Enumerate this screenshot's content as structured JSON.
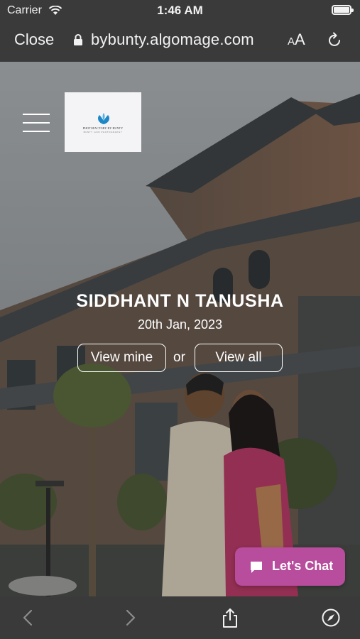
{
  "status_bar": {
    "carrier": "Carrier",
    "time": "1:46 AM",
    "battery_level": 1.0
  },
  "browser": {
    "close_label": "Close",
    "url": "bybunty.algomage.com",
    "text_size_small": "A",
    "text_size_big": "A",
    "icons": {
      "lock": "lock-icon",
      "reload": "reload-icon",
      "back": "back-arrow-icon",
      "forward": "forward-arrow-icon",
      "share": "share-icon",
      "compass": "compass-icon"
    }
  },
  "page": {
    "logo_name": "PHOTOFACTORY BY BUNTY",
    "logo_tagline": "BUNTY JAIN PHOTOGRAPHY",
    "couple_name": "SIDDHANT N TANUSHA",
    "event_date": "20th Jan, 2023",
    "view_mine_label": "View mine",
    "or_label": "or",
    "view_all_label": "View all",
    "chat_label": "Let's Chat"
  },
  "colors": {
    "chrome_bg": "#3a3a3a",
    "chat_accent": "#b74d9c",
    "logo_blue": "#1e88c7"
  }
}
